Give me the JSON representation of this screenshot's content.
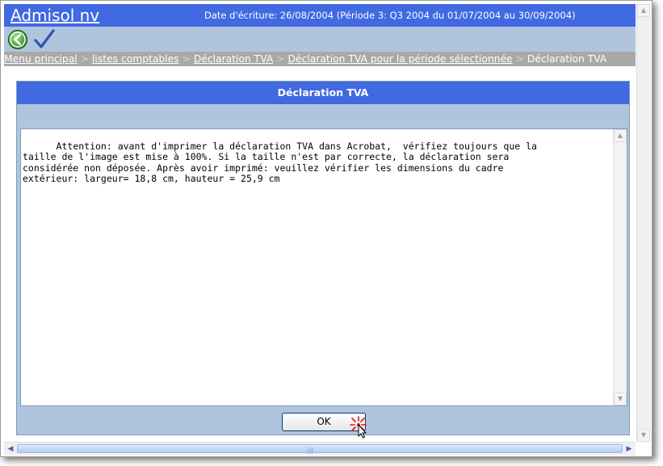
{
  "header": {
    "app_title": "Admisol nv",
    "date_info": "Date d'écriture: 26/08/2004 (Période 3: Q3 2004 du 01/07/2004 au 30/09/2004)"
  },
  "toolbar": {
    "back_icon": "back-arrow-icon",
    "confirm_icon": "checkmark-icon"
  },
  "breadcrumb": {
    "items": [
      "Menu principal",
      "listes comptables",
      "Déclaration TVA",
      "Déclaration TVA pour la période sélectionnée"
    ],
    "separator": ">",
    "current": "Déclaration TVA"
  },
  "dialog": {
    "title": "Déclaration TVA",
    "message": "Attention: avant d'imprimer la déclaration TVA dans Acrobat,  vérifiez toujours que la\ntaille de l'image est mise à 100%. Si la taille n'est par correcte, la déclaration sera\nconsidérée non déposée. Après avoir imprimé: veuillez vérifier les dimensions du cadre\nextérieur: largeur= 18,8 cm, hauteur = 25,9 cm",
    "ok_label": "OK"
  },
  "colors": {
    "header_blue": "#4169e1",
    "panel_lightblue": "#b0c4de",
    "breadcrumb_gray": "#a9a9a9"
  }
}
